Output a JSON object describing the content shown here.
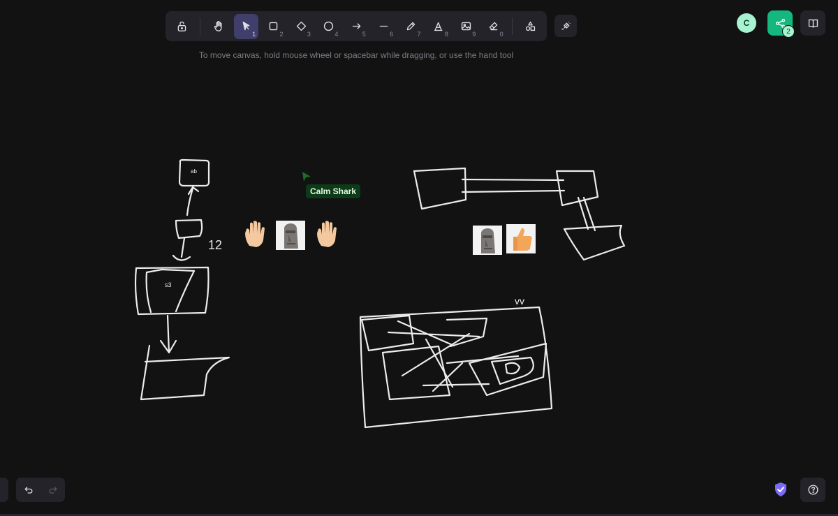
{
  "toolbar": {
    "tools": [
      {
        "name": "lock",
        "key": ""
      },
      {
        "name": "hand",
        "key": ""
      },
      {
        "name": "selection",
        "key": "1"
      },
      {
        "name": "rectangle",
        "key": "2"
      },
      {
        "name": "diamond",
        "key": "3"
      },
      {
        "name": "ellipse",
        "key": "4"
      },
      {
        "name": "arrow",
        "key": "5"
      },
      {
        "name": "line",
        "key": "6"
      },
      {
        "name": "draw",
        "key": "7"
      },
      {
        "name": "text",
        "key": "8"
      },
      {
        "name": "image",
        "key": "9"
      },
      {
        "name": "eraser",
        "key": "0"
      },
      {
        "name": "extra-tools",
        "key": ""
      }
    ],
    "active_tool": "selection"
  },
  "hint": "To move canvas, hold mouse wheel or spacebar while dragging, or use the hand tool",
  "collaborators": {
    "avatar_initial": "C",
    "share_count": "2",
    "pointer_name": "Calm Shark",
    "pointer_color": "#0d3b17"
  },
  "canvas": {
    "small_box_label": "ab",
    "number_label": "12",
    "s3_label": "s3",
    "vv_label": "vv"
  },
  "colors": {
    "background": "#121212",
    "accent": "#403e6a",
    "share": "#14b87f"
  },
  "icons": [
    "lock-icon",
    "hand-icon",
    "pointer-icon",
    "square-icon",
    "diamond-icon",
    "circle-icon",
    "arrow-icon",
    "line-icon",
    "pencil-icon",
    "text-icon",
    "image-icon",
    "eraser-icon",
    "shapes-icon",
    "laser-icon",
    "share-icon",
    "book-icon",
    "undo-icon",
    "redo-icon",
    "shield-icon",
    "help-icon"
  ]
}
